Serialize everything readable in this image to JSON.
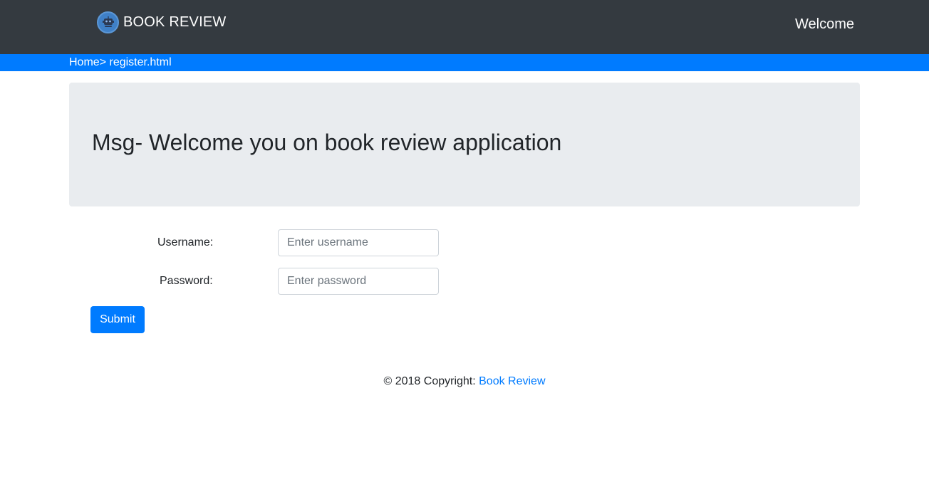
{
  "navbar": {
    "brand_label": "BOOK REVIEW",
    "brand_icon": "robot-icon",
    "welcome_label": "Welcome"
  },
  "breadcrumb": {
    "home_label": "Home",
    "separator": "> ",
    "current_label": "register.html"
  },
  "jumbotron": {
    "message": "Msg- Welcome you on book review application"
  },
  "form": {
    "username_label": "Username:",
    "username_placeholder": "Enter username",
    "username_value": "",
    "password_label": "Password:",
    "password_placeholder": "Enter password",
    "password_value": "",
    "submit_label": "Submit"
  },
  "footer": {
    "copyright_text": "© 2018 Copyright: ",
    "link_label": "Book Review"
  },
  "colors": {
    "navbar_bg": "#343a40",
    "primary": "#007bff",
    "jumbotron_bg": "#e9ecef"
  }
}
